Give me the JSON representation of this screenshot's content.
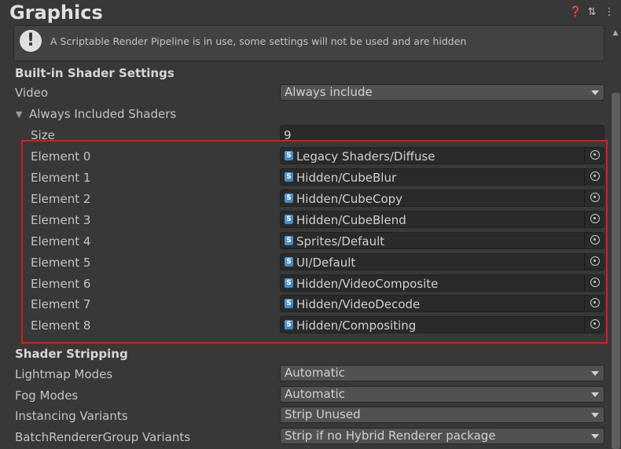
{
  "header": {
    "title": "Graphics",
    "icons": [
      "help-icon",
      "layout-icon",
      "menu-icon"
    ]
  },
  "help_box": {
    "text": "A Scriptable Render Pipeline is in use, some settings will not be used and are hidden"
  },
  "builtin": {
    "section_label": "Built-in Shader Settings",
    "video_label": "Video",
    "video_value": "Always include",
    "always_included_label": "Always Included Shaders",
    "size_label": "Size",
    "size_value": "9",
    "elements": [
      {
        "label": "Element 0",
        "value": "Legacy Shaders/Diffuse"
      },
      {
        "label": "Element 1",
        "value": "Hidden/CubeBlur"
      },
      {
        "label": "Element 2",
        "value": "Hidden/CubeCopy"
      },
      {
        "label": "Element 3",
        "value": "Hidden/CubeBlend"
      },
      {
        "label": "Element 4",
        "value": "Sprites/Default"
      },
      {
        "label": "Element 5",
        "value": "UI/Default"
      },
      {
        "label": "Element 6",
        "value": "Hidden/VideoComposite"
      },
      {
        "label": "Element 7",
        "value": "Hidden/VideoDecode"
      },
      {
        "label": "Element 8",
        "value": "Hidden/Compositing"
      }
    ]
  },
  "stripping": {
    "section_label": "Shader Stripping",
    "rows": [
      {
        "label": "Lightmap Modes",
        "value": "Automatic"
      },
      {
        "label": "Fog Modes",
        "value": "Automatic"
      },
      {
        "label": "Instancing Variants",
        "value": "Strip Unused"
      },
      {
        "label": "BatchRendererGroup Variants",
        "value": "Strip if no Hybrid Renderer package"
      }
    ]
  },
  "colors": {
    "background": "#383838",
    "highlight_border": "#d81c1c",
    "field_bg": "#2a2a2a",
    "dropdown_bg": "#515151"
  }
}
